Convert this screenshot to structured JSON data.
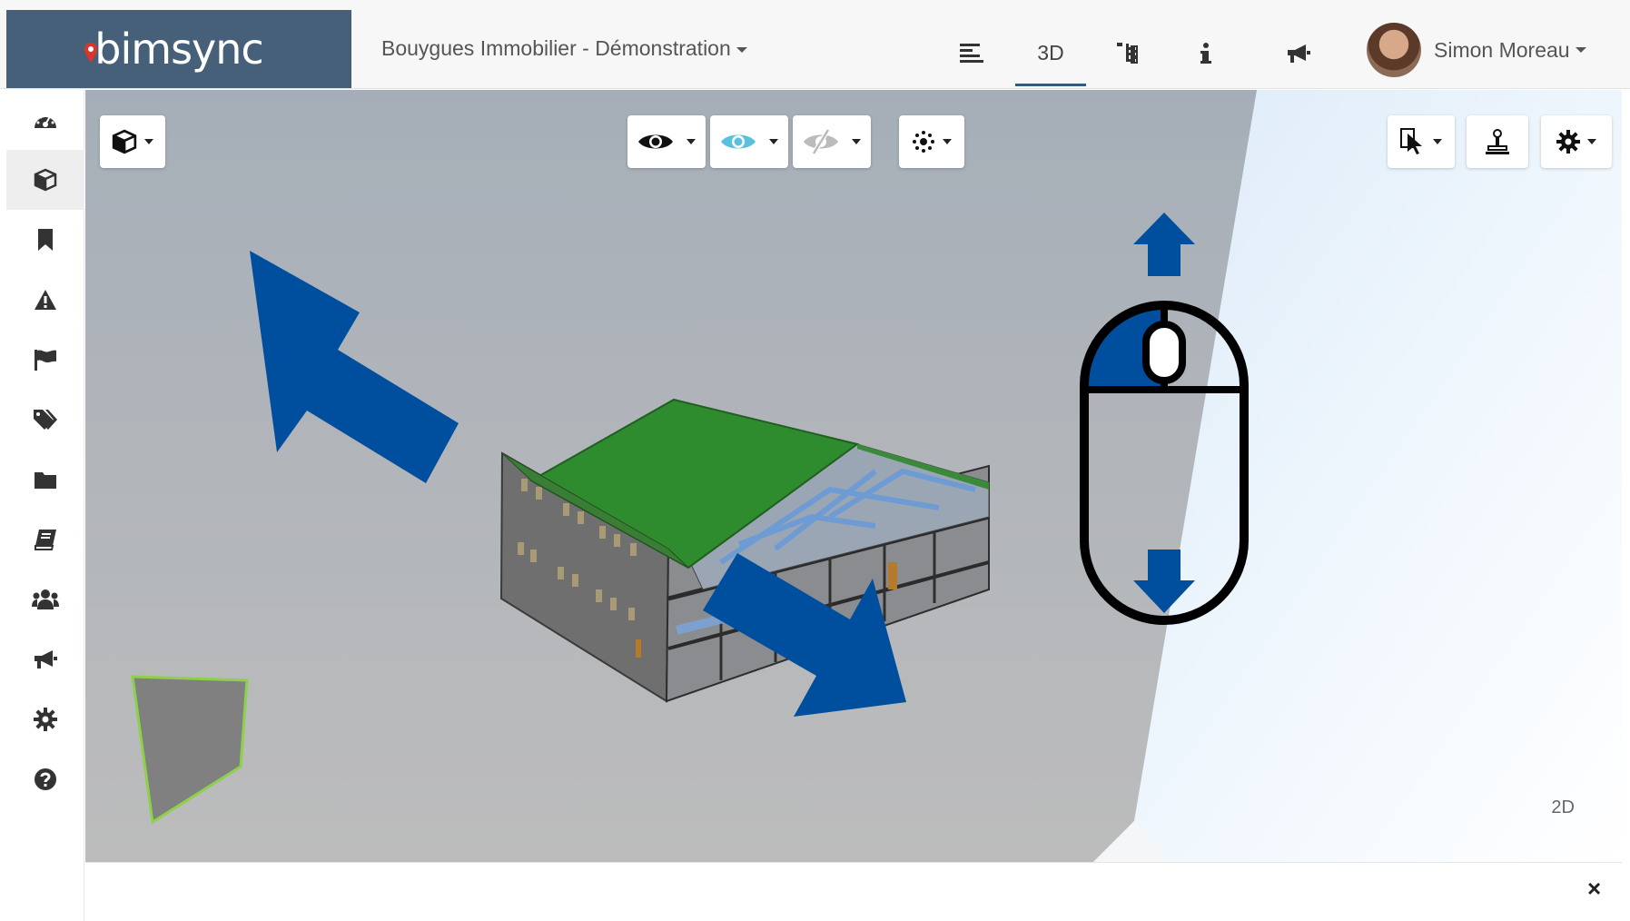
{
  "app": {
    "brand_text": "bimsync",
    "brand_bg": "#466079",
    "pin_color": "#d9352a"
  },
  "header": {
    "project_name": "Bouygues Immobilier - Démonstration",
    "nav": [
      {
        "id": "list",
        "icon": "list-lines-icon",
        "label": ""
      },
      {
        "id": "3d",
        "icon": "",
        "label": "3D"
      },
      {
        "id": "tree",
        "icon": "hierarchy-tree-icon",
        "label": ""
      },
      {
        "id": "info",
        "icon": "info-icon",
        "label": ""
      },
      {
        "id": "announce",
        "icon": "megaphone-icon",
        "label": ""
      }
    ],
    "active_tab": "3D",
    "user_name": "Simon Moreau"
  },
  "sidebar": {
    "items": [
      {
        "icon": "dashboard-gauge-icon"
      },
      {
        "icon": "cube-icon",
        "active": true
      },
      {
        "icon": "bookmark-icon"
      },
      {
        "icon": "warning-triangle-icon"
      },
      {
        "icon": "flag-icon"
      },
      {
        "icon": "tags-icon"
      },
      {
        "icon": "folder-icon"
      },
      {
        "icon": "book-icon"
      },
      {
        "icon": "users-group-icon"
      },
      {
        "icon": "megaphone-icon"
      },
      {
        "icon": "gear-icon"
      },
      {
        "icon": "question-circle-icon"
      }
    ]
  },
  "viewer": {
    "toolbar_left": [
      {
        "icon": "cube-view-icon"
      }
    ],
    "toolbar_center": [
      {
        "icon": "eye-icon"
      },
      {
        "icon": "eye-colored-icon",
        "color": "#5bc0de"
      },
      {
        "icon": "eye-slash-icon"
      },
      {
        "icon": "explode-icon"
      }
    ],
    "toolbar_right": [
      {
        "icon": "select-cursor-icon"
      },
      {
        "icon": "section-stamp-icon"
      },
      {
        "icon": "gear-icon"
      }
    ],
    "label_2d": "2D",
    "close_symbol": "×",
    "colors": {
      "arrow_blue": "#004f9f",
      "roof_green": "#2e8b2e",
      "background_gray": "#aab0b8",
      "sky_blue": "#e8f3fd"
    },
    "overlays": [
      {
        "icon": "pan-arrow-upleft-icon"
      },
      {
        "icon": "pan-arrow-downright-icon"
      },
      {
        "icon": "mouse-scroll-icon"
      },
      {
        "icon": "arrow-up-icon"
      },
      {
        "icon": "arrow-down-icon"
      }
    ]
  }
}
